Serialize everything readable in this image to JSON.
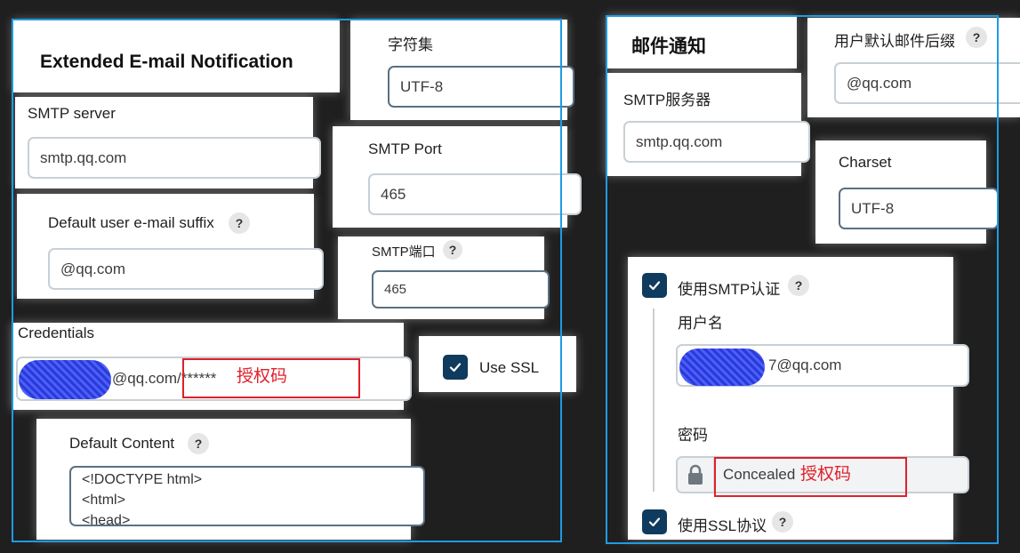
{
  "left": {
    "title": "Extended E-mail Notification",
    "charset_cn_label": "字符集",
    "charset_cn_value": "UTF-8",
    "smtp_server_label": "SMTP server",
    "smtp_server_value": "smtp.qq.com",
    "smtp_port_label": "SMTP Port",
    "smtp_port_value": "465",
    "default_suffix_label": "Default user e-mail suffix",
    "default_suffix_value": "@qq.com",
    "smtp_port_cn_label": "SMTP端口",
    "smtp_port_cn_value": "465",
    "credentials_label": "Credentials",
    "credentials_value": "@qq.com/******",
    "credentials_annotation": "授权码",
    "use_ssl_label": "Use SSL",
    "default_content_label": "Default Content",
    "default_content_lines": [
      "<!DOCTYPE html>",
      "<html>",
      "<head>"
    ]
  },
  "right": {
    "title": "邮件通知",
    "default_suffix_label": "用户默认邮件后缀",
    "default_suffix_value": "@qq.com",
    "smtp_server_label": "SMTP服务器",
    "smtp_server_value": "smtp.qq.com",
    "charset_label": "Charset",
    "charset_value": "UTF-8",
    "use_smtp_auth_label": "使用SMTP认证",
    "username_label": "用户名",
    "username_value": "7@qq.com",
    "password_label": "密码",
    "password_value": "Concealed",
    "password_annotation": "授权码",
    "use_ssl_label": "使用SSL协议"
  },
  "help_glyph": "?",
  "icons": [
    "help-icon",
    "check-icon",
    "lock-icon"
  ],
  "colors": {
    "background": "#1f1f1f",
    "frame": "#1e9be5",
    "checkbox": "#0e3b5e",
    "annotation": "#e0202a",
    "redaction": "#2a3bd6"
  }
}
